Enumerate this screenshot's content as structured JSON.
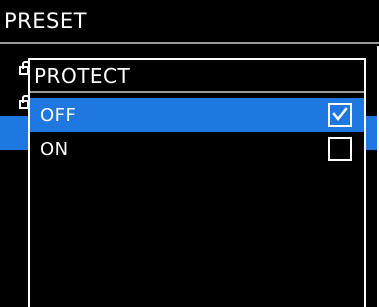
{
  "screen": {
    "title": "PRESET"
  },
  "popup": {
    "title": "PROTECT",
    "options": [
      {
        "label": "OFF",
        "checked": true,
        "selected": true
      },
      {
        "label": "ON",
        "checked": false,
        "selected": false
      }
    ]
  },
  "colors": {
    "highlight": "#1e78e0",
    "background": "#000000",
    "text": "#ffffff",
    "divider": "#9a9a9a"
  },
  "icons": {
    "lock": "lock-icon",
    "check": "checkmark-icon"
  }
}
